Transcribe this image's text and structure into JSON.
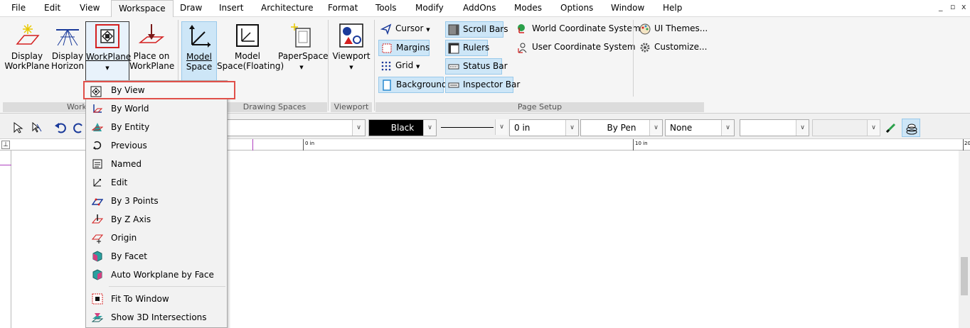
{
  "menu": [
    "File",
    "Edit",
    "View",
    "Workspace",
    "Draw",
    "Insert",
    "Architecture",
    "Format",
    "Tools",
    "Modify",
    "AddOns",
    "Modes",
    "Options",
    "Window",
    "Help"
  ],
  "window_controls": [
    "_",
    "▫",
    "x"
  ],
  "ribbon": {
    "display_workplane": [
      "Display",
      "WorkPlane"
    ],
    "display_horizon": [
      "Display",
      "Horizon"
    ],
    "workplane": "WorkPlane",
    "place_on_workplane": [
      "Place on",
      "WorkPlane"
    ],
    "model_space": [
      "Model",
      "Space"
    ],
    "model_space_floating": [
      "Model",
      "Space(Floating)"
    ],
    "paperspace": "PaperSpace",
    "viewport": "Viewport",
    "cursor": "Cursor",
    "margins": "Margins",
    "grid": "Grid",
    "background": "Background",
    "scroll_bars": "Scroll Bars",
    "rulers": "Rulers",
    "status_bar": "Status Bar",
    "inspector_bar": "Inspector Bar",
    "world_cs": "World Coordinate System",
    "user_cs": "User Coordinate System",
    "ui_themes": "UI Themes...",
    "customize": "Customize...",
    "groups": {
      "workspace": "Work",
      "drawing_spaces": "Drawing Spaces",
      "viewport": "Viewport",
      "page_setup": "Page Setup"
    }
  },
  "toolbar": {
    "color_value": "Black",
    "thickness_value": "0 in",
    "pen_value": "By Pen",
    "fill_value": "None"
  },
  "ruler": {
    "mark0": "0 in",
    "mark10": "10 in",
    "mark20": "20"
  },
  "dropdown": {
    "items": [
      "By View",
      "By World",
      "By Entity",
      "Previous",
      "Named",
      "Edit",
      "By 3 Points",
      "By Z Axis",
      "Origin",
      "By Facet",
      "Auto Workplane by Face",
      "Fit To Window",
      "Show 3D Intersections"
    ]
  },
  "colors": {
    "selected_bg": "#cde6f7",
    "highlight_border": "#e0504a",
    "accent_red": "#d42020"
  }
}
